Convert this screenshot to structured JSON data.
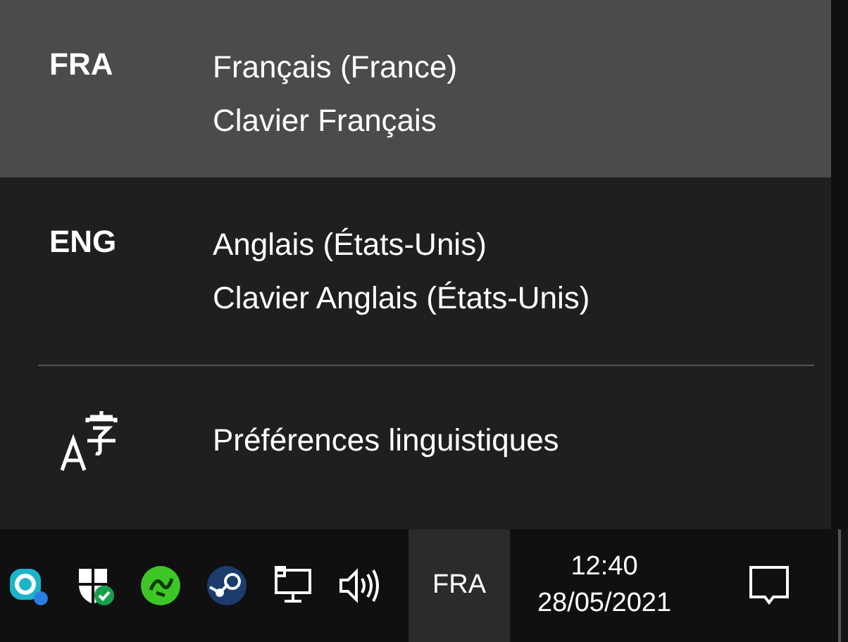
{
  "languages": [
    {
      "code": "FRA",
      "name": "Français (France)",
      "keyboard": "Clavier Français",
      "selected": true
    },
    {
      "code": "ENG",
      "name": "Anglais (États-Unis)",
      "keyboard": "Clavier Anglais (États-Unis)",
      "selected": false
    }
  ],
  "preferences": {
    "label": "Préférences linguistiques"
  },
  "taskbar": {
    "input_indicator": "FRA",
    "time": "12:40",
    "date": "28/05/2021"
  }
}
